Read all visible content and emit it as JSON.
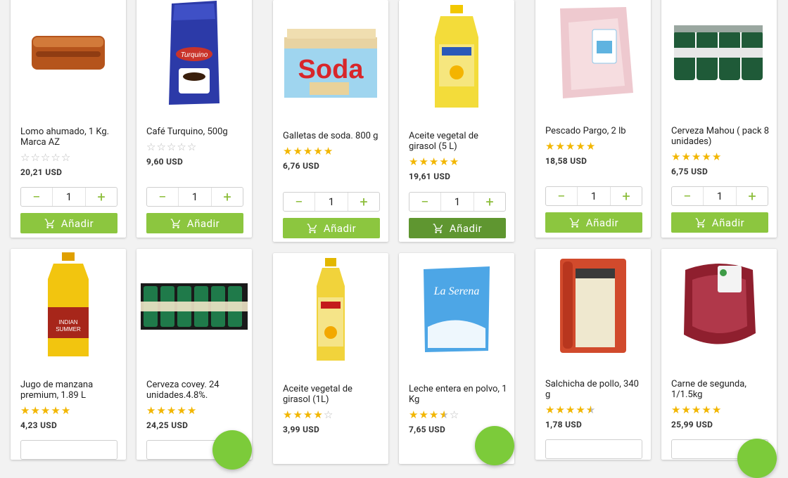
{
  "add_label": "Añadir",
  "colors": {
    "accent": "#8cc63f",
    "accent_dark": "#5f9630",
    "star": "#f2b600"
  },
  "products": [
    {
      "name": "Lomo ahumado, 1 Kg. Marca AZ",
      "rating": 0,
      "price": "20,21 USD",
      "qty": "1",
      "icon": "smoked-pork-loin-image"
    },
    {
      "name": "Café Turquino, 500g",
      "rating": 0,
      "price": "9,60 USD",
      "qty": "1",
      "icon": "coffee-bag-image"
    },
    {
      "name": "Galletas de soda. 800 g",
      "rating": 5,
      "price": "6,76 USD",
      "qty": "1",
      "icon": "soda-crackers-box-image"
    },
    {
      "name": "Aceite vegetal de girasol (5 L)",
      "rating": 5,
      "price": "19,61 USD",
      "qty": "1",
      "icon": "oil-jug-image"
    },
    {
      "name": "Pescado Pargo, 2 lb",
      "rating": 5,
      "price": "18,58 USD",
      "qty": "1",
      "icon": "fish-fillet-image"
    },
    {
      "name": "Cerveza Mahou ( pack 8 unidades)",
      "rating": 5,
      "price": "6,75 USD",
      "qty": "1",
      "icon": "beer-cans-pack-image"
    },
    {
      "name": "Jugo de manzana premium, 1.89 L",
      "rating": 5,
      "price": "4,23 USD",
      "icon": "apple-juice-bottle-image"
    },
    {
      "name": "Cerveza covey. 24 unidades.4.8%.",
      "rating": 5,
      "price": "24,25 USD",
      "icon": "beer-case-image"
    },
    {
      "name": "Aceite vegetal de girasol (1L)",
      "rating": 4,
      "price": "3,99 USD",
      "icon": "oil-bottle-image"
    },
    {
      "name": "Leche entera en polvo, 1 Kg",
      "rating": 3.5,
      "price": "7,65 USD",
      "icon": "milk-powder-bag-image"
    },
    {
      "name": "Salchicha de pollo, 340 g",
      "rating": 4.5,
      "price": "1,78 USD",
      "icon": "chicken-sausage-pack-image"
    },
    {
      "name": "Carne de segunda, 1/1.5kg",
      "rating": 5,
      "price": "25,99 USD",
      "icon": "beef-meat-pack-image"
    }
  ]
}
